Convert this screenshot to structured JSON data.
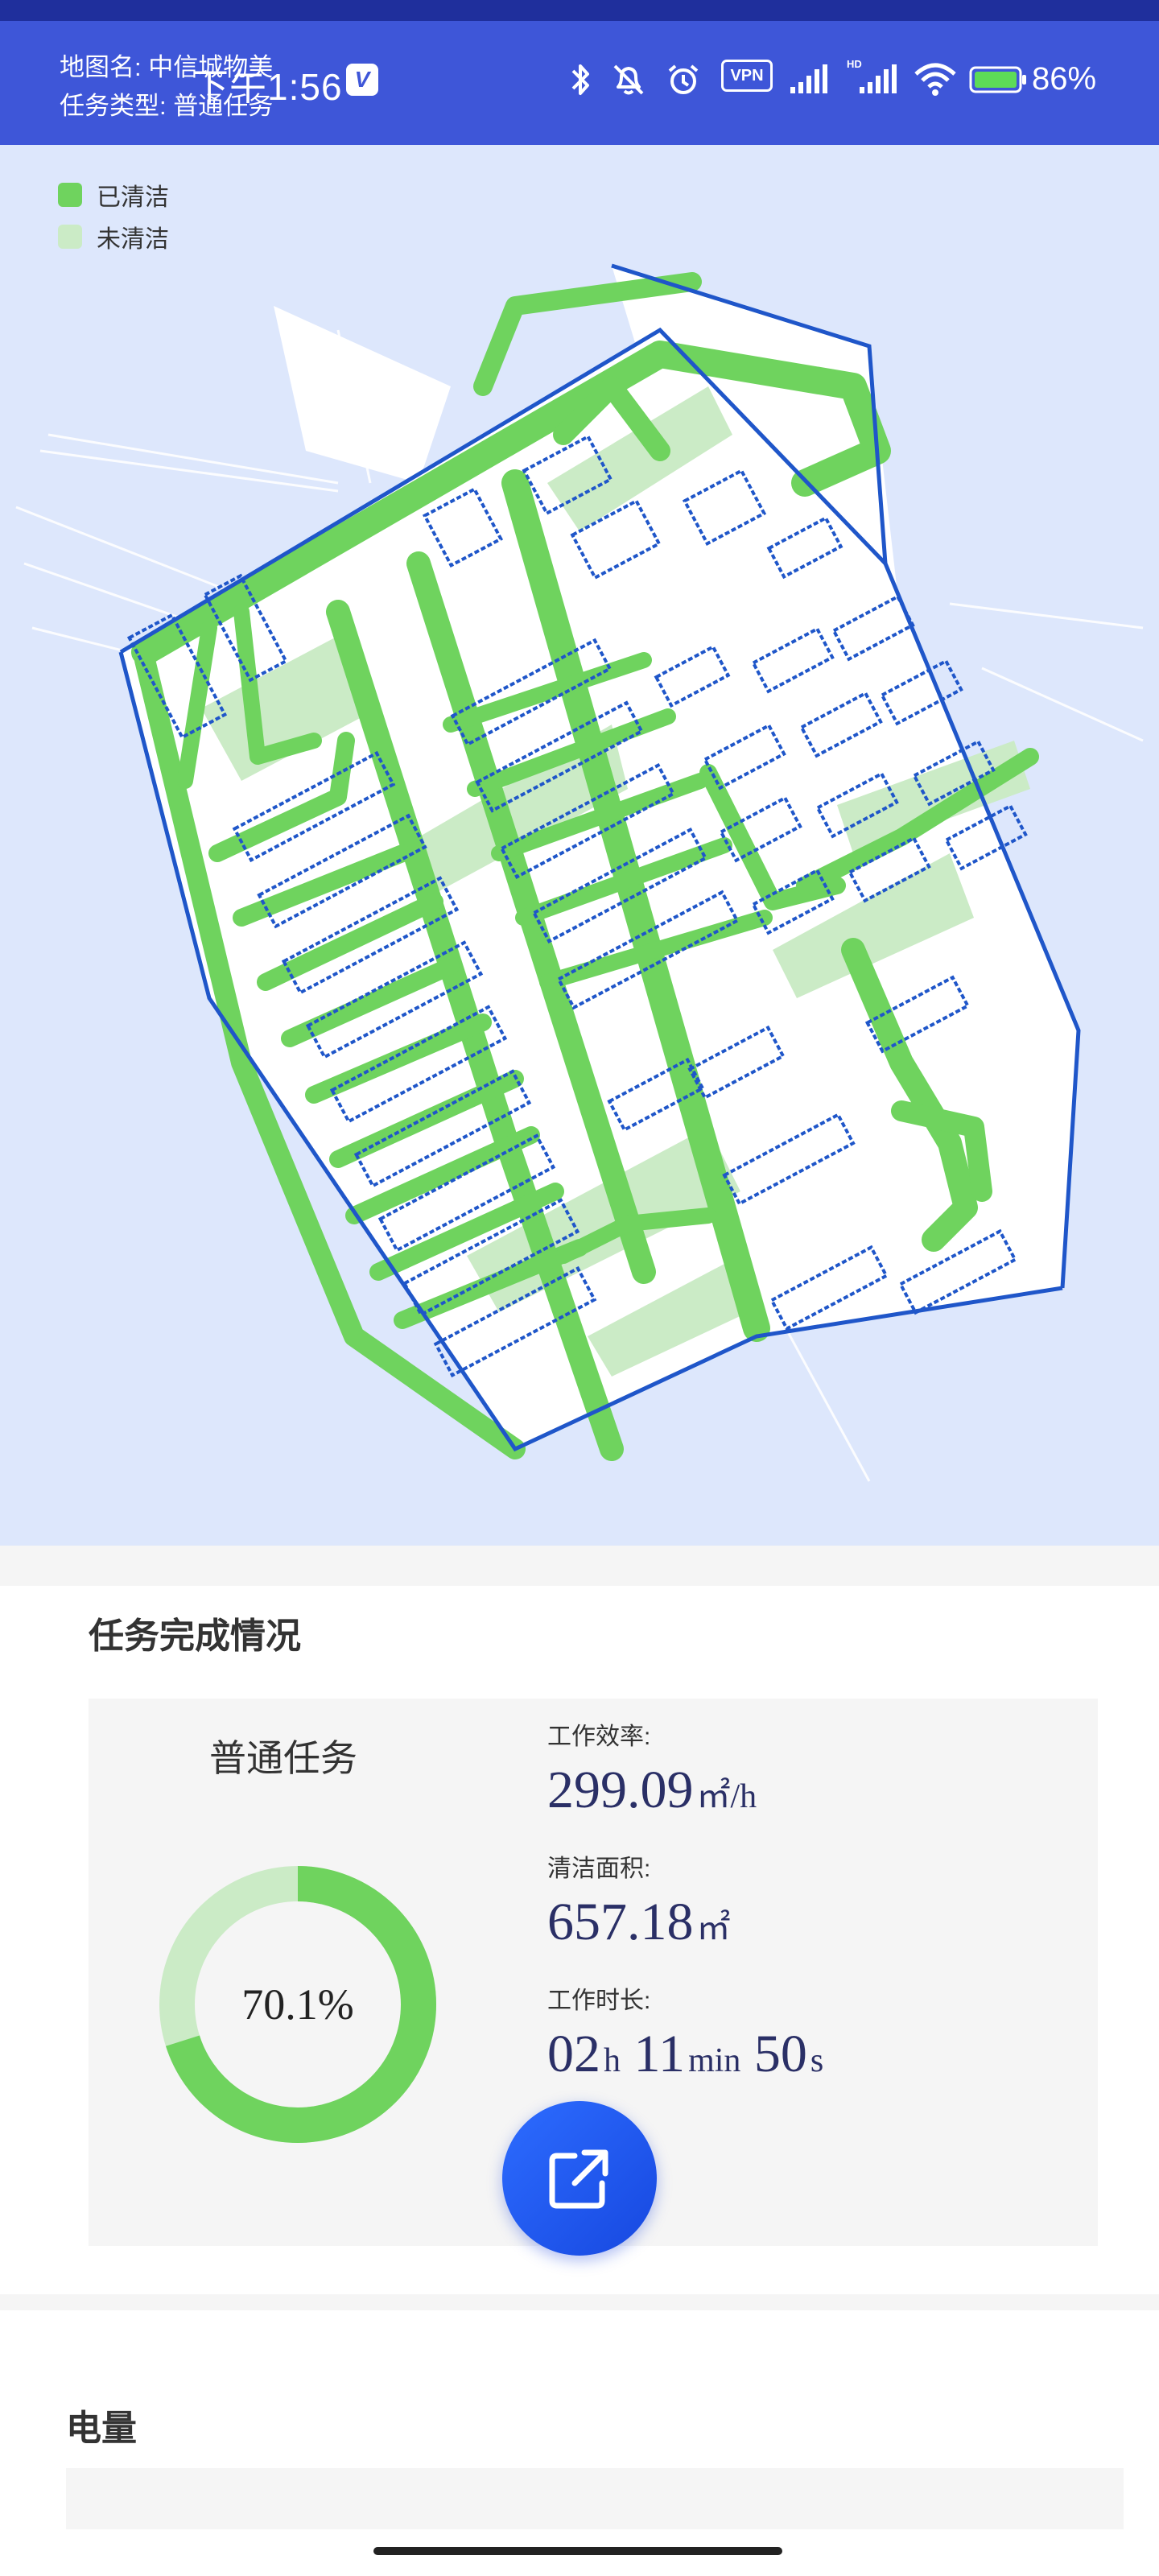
{
  "header": {
    "map_name": "地图名: 中信城物美",
    "task_type": "任务类型: 普通任务"
  },
  "status_bar": {
    "time": "下午1:56",
    "badge": "V",
    "vpn": "VPN",
    "battery": "86%"
  },
  "legend": [
    {
      "label": "已清洁",
      "color": "#6fd35e"
    },
    {
      "label": "未清洁",
      "color": "#cbebc6"
    }
  ],
  "task_completion": {
    "title": "任务完成情况",
    "task_name": "普通任务",
    "completion_percent": 70.1,
    "completion_label": "70.1%",
    "stats": [
      {
        "label": "工作效率:",
        "value": "299.09",
        "unit": "㎡/h"
      },
      {
        "label": "清洁面积:",
        "value": "657.18",
        "unit": "㎡"
      },
      {
        "label": "工作时长:",
        "parts": [
          "02",
          "h",
          " 11",
          "min",
          " 50",
          "s"
        ]
      }
    ]
  },
  "battery_section": {
    "title": "电量"
  },
  "colors": {
    "header_bg": "#3e56d8",
    "map_bg": "#dde7fc",
    "cleaned": "#6fd35e",
    "uncleaned": "#cbebc6",
    "wall": "#1f56c9",
    "accent_button": "#2d6cff"
  }
}
